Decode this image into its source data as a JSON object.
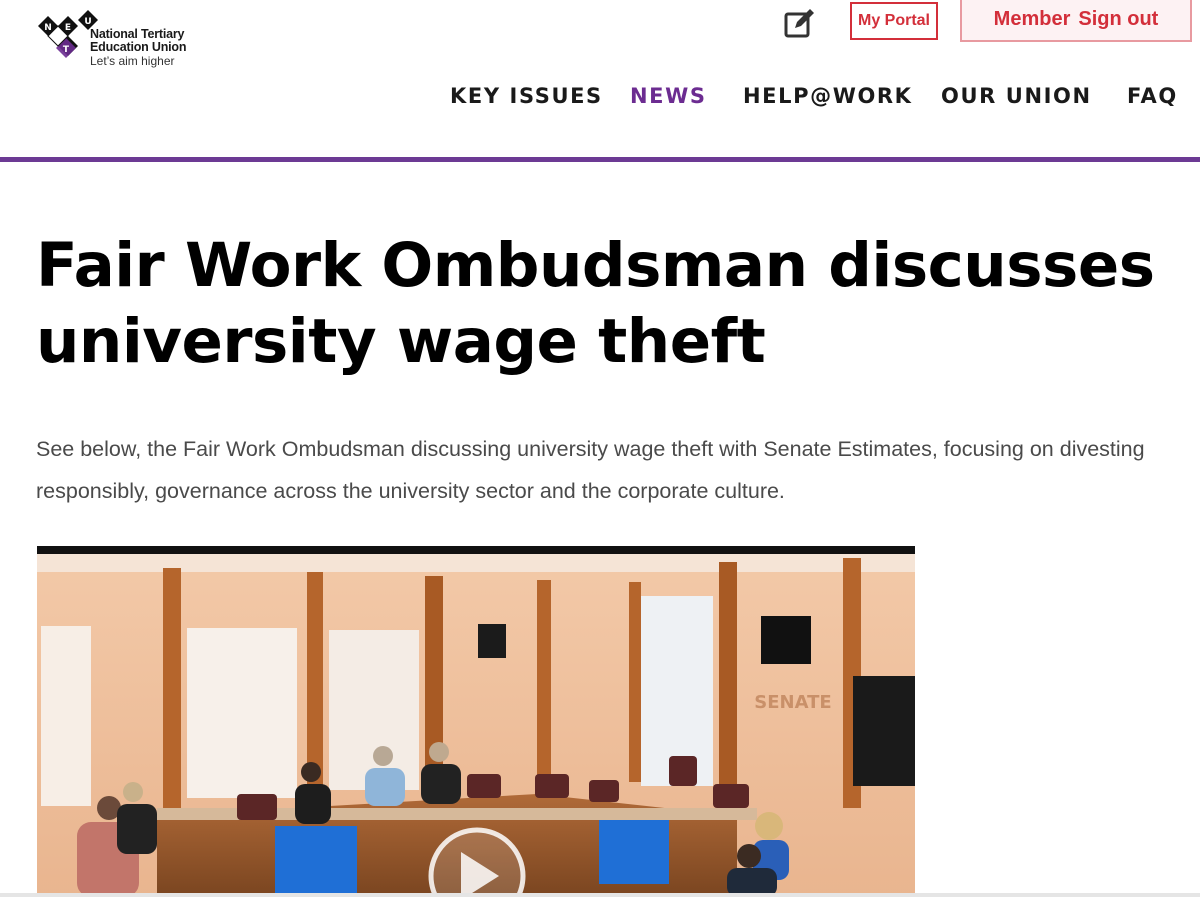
{
  "logo": {
    "letters": [
      "N",
      "T",
      "E",
      "U"
    ],
    "line1": "National Tertiary",
    "line2": "Education Union",
    "tagline": "Let’s aim higher",
    "colors": {
      "dark": "#111111",
      "purple": "#6c2c91"
    }
  },
  "header": {
    "edit_icon": "edit-square-icon",
    "portal_label": "My Portal",
    "member_label": "Member",
    "signout_label": "Sign out",
    "accent": "#d32f3a"
  },
  "nav": {
    "items": [
      {
        "label": "KEY ISSUES",
        "active": false
      },
      {
        "label": "NEWS",
        "active": true
      },
      {
        "label": "HELP@WORK",
        "active": false
      },
      {
        "label": "OUR UNION",
        "active": false
      },
      {
        "label": "FAQ",
        "active": false
      }
    ],
    "active_color": "#6c2c91",
    "rule_color": "#6c3a94"
  },
  "article": {
    "title": "Fair Work Ombudsman discusses university wage theft",
    "intro": "See below, the Fair Work Ombudsman discussing university wage theft with Senate Estimates, focusing on divesting responsibly, governance across the university sector and the corporate culture."
  },
  "video": {
    "play_icon": "play-icon",
    "wall_sign": "SENATE"
  }
}
